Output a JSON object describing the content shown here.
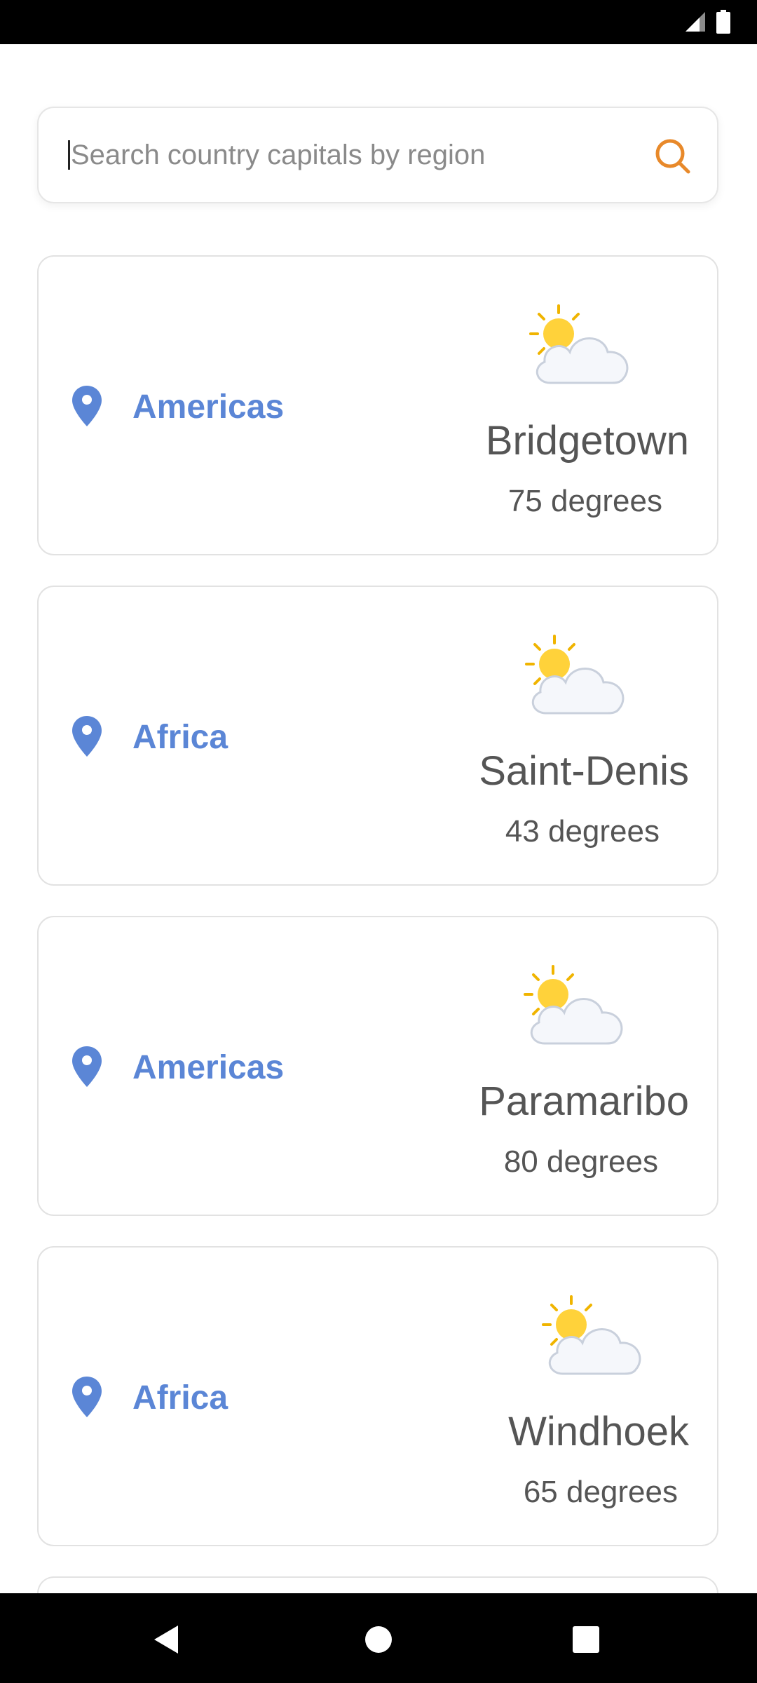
{
  "search": {
    "placeholder": "Search country capitals by region",
    "value": ""
  },
  "cards": [
    {
      "region": "Americas",
      "city": "Bridgetown",
      "temperature": "75 degrees",
      "weather_icon": "sun-behind-cloud-icon"
    },
    {
      "region": "Africa",
      "city": "Saint-Denis",
      "temperature": "43 degrees",
      "weather_icon": "sun-behind-cloud-icon"
    },
    {
      "region": "Americas",
      "city": "Paramaribo",
      "temperature": "80 degrees",
      "weather_icon": "sun-behind-cloud-icon"
    },
    {
      "region": "Africa",
      "city": "Windhoek",
      "temperature": "65 degrees",
      "weather_icon": "sun-behind-cloud-icon"
    }
  ],
  "colors": {
    "accent_region": "#5b86d6",
    "search_icon": "#e8892a",
    "text_primary": "#555555",
    "card_border": "#e2e2e2",
    "system_bar": "#000000"
  },
  "nav": {
    "back_icon": "back-triangle-icon",
    "home_icon": "home-circle-icon",
    "recents_icon": "recents-square-icon"
  }
}
